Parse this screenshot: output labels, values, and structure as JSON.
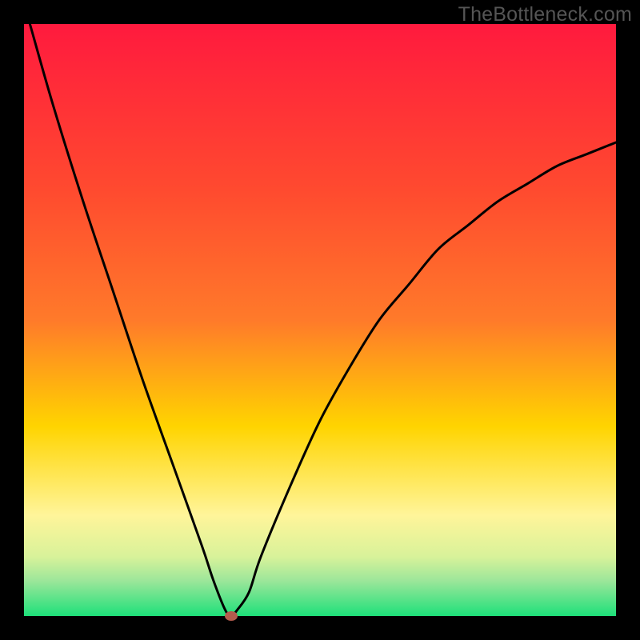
{
  "watermark": "TheBottleneck.com",
  "chart_data": {
    "type": "line",
    "title": "",
    "xlabel": "",
    "ylabel": "",
    "xlim": [
      0,
      100
    ],
    "ylim": [
      0,
      100
    ],
    "x": [
      1,
      5,
      10,
      15,
      20,
      25,
      30,
      32,
      34,
      35,
      36,
      38,
      40,
      45,
      50,
      55,
      60,
      65,
      70,
      75,
      80,
      85,
      90,
      95,
      100
    ],
    "values": [
      100,
      86,
      70,
      55,
      40,
      26,
      12,
      6,
      1,
      0,
      1,
      4,
      10,
      22,
      33,
      42,
      50,
      56,
      62,
      66,
      70,
      73,
      76,
      78,
      80
    ],
    "marker": {
      "x": 35,
      "y": 0,
      "color": "#b55b4d"
    },
    "gradient": {
      "top": "#ff1a3e",
      "mid1": "#ff7a2a",
      "mid2": "#ffd400",
      "low": "#fff59a",
      "base1": "#d8f29a",
      "base2": "#9de69a",
      "bottom": "#1ee07a"
    },
    "frame_color": "#000000",
    "line_color": "#000000"
  }
}
